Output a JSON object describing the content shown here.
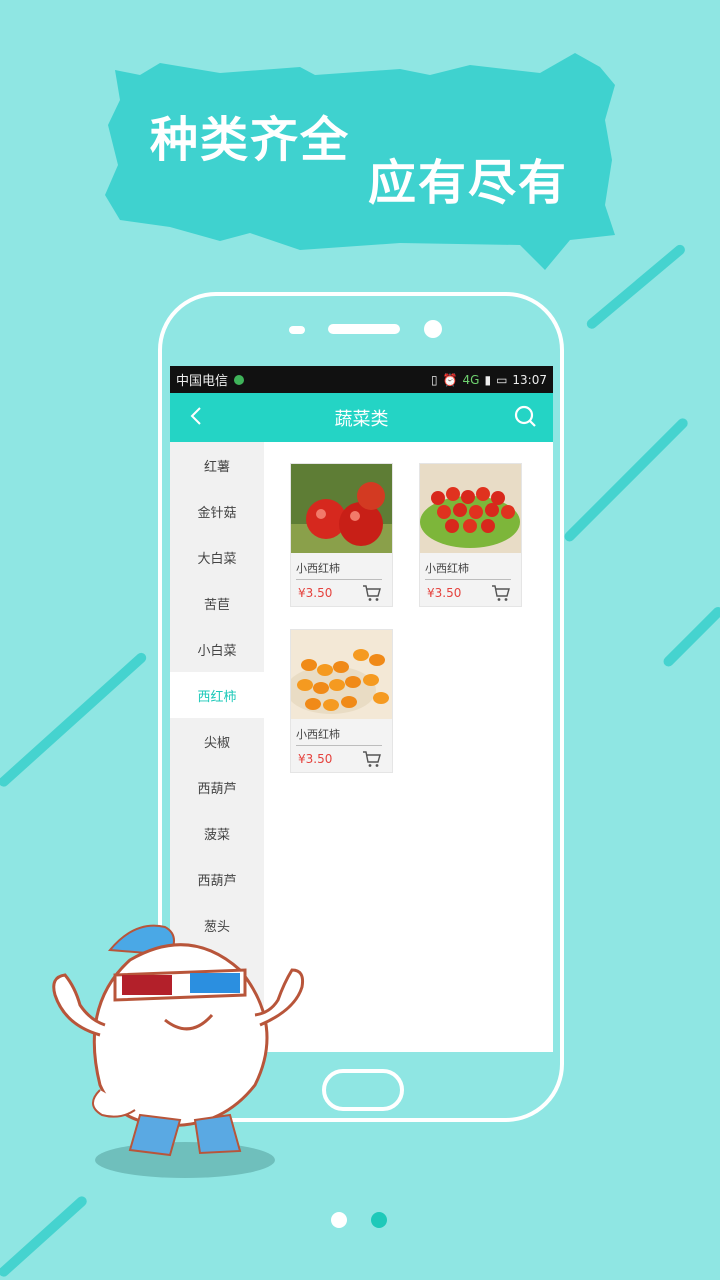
{
  "banner": {
    "line1": "种类齐全",
    "line2": "应有尽有"
  },
  "status_bar": {
    "carrier": "中国电信",
    "network": "4G",
    "time": "13:07"
  },
  "app_bar": {
    "title": "蔬菜类"
  },
  "categories": [
    "红薯",
    "金针菇",
    "大白菜",
    "苦苣",
    "小白菜",
    "西红柿",
    "尖椒",
    "西葫芦",
    "菠菜",
    "西葫芦",
    "葱头"
  ],
  "active_category_index": 5,
  "products": [
    {
      "name": "小西红柿",
      "price": "¥3.50"
    },
    {
      "name": "小西红柿",
      "price": "¥3.50"
    },
    {
      "name": "小西红柿",
      "price": "¥3.50"
    }
  ],
  "pagination": {
    "total": 2,
    "current": 2
  },
  "colors": {
    "background": "#8fe6e3",
    "accent": "#24d4c5",
    "price": "#e5433e"
  }
}
